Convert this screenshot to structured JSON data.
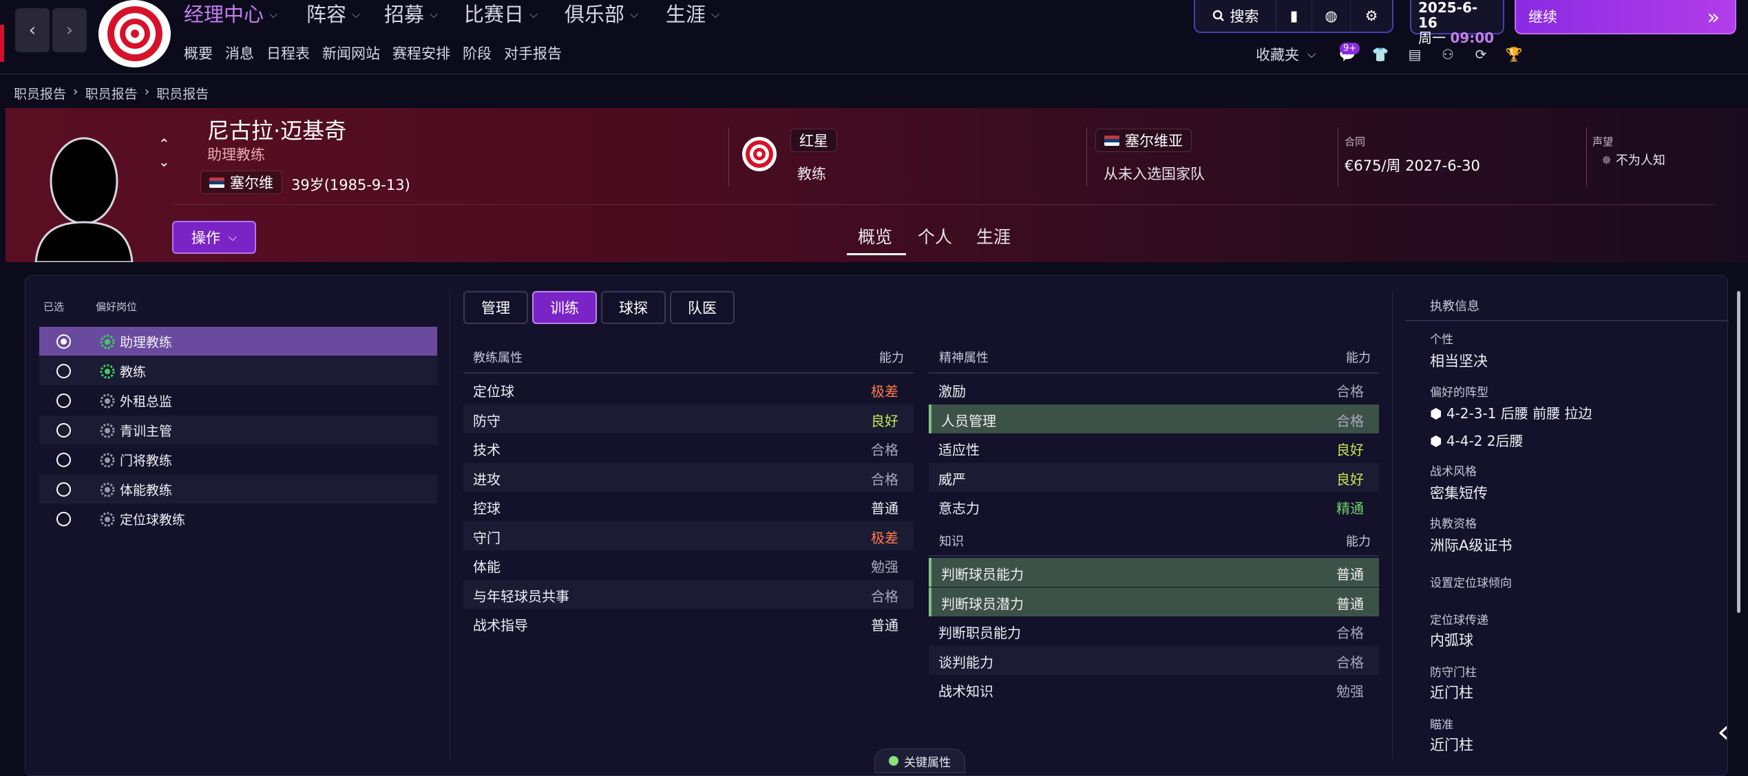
{
  "nav": {
    "main": [
      {
        "label": "经理中心"
      },
      {
        "label": "阵容"
      },
      {
        "label": "招募"
      },
      {
        "label": "比赛日"
      },
      {
        "label": "俱乐部"
      },
      {
        "label": "生涯"
      }
    ],
    "sub": [
      "概要",
      "消息",
      "日程表",
      "新闻网站",
      "赛程安排",
      "阶段",
      "对手报告"
    ],
    "search_label": "搜索",
    "date": "2025-6-16",
    "weekday": "周一",
    "time": "09:00",
    "continue_label": "继续",
    "favorites_label": "收藏夹",
    "message_badge": "9+"
  },
  "breadcrumb": [
    "职员报告",
    "职员报告",
    "职员报告"
  ],
  "profile": {
    "name": "尼古拉·迈基奇",
    "role": "助理教练",
    "nationality": "塞尔维",
    "age": "39岁(1985-9-13)",
    "club": "红星",
    "club_role": "教练",
    "national_team": "塞尔维亚",
    "national_status": "从未入选国家队",
    "contract_label": "合同",
    "contract_value": "€675/周  2027-6-30",
    "reputation_label": "声望",
    "reputation_value": "不为人知",
    "action_label": "操作",
    "tabs": [
      "概览",
      "个人",
      "生涯"
    ]
  },
  "positions": {
    "header_selected": "已选",
    "header_position": "偏好岗位",
    "items": [
      {
        "label": "助理教练",
        "selected": true,
        "star_color": "#3ecf5a"
      },
      {
        "label": "教练",
        "selected": false,
        "star_color": "#3ecf5a"
      },
      {
        "label": "外租总监",
        "selected": false,
        "star_color": "#9a98a8"
      },
      {
        "label": "青训主管",
        "selected": false,
        "star_color": "#9a98a8"
      },
      {
        "label": "门将教练",
        "selected": false,
        "star_color": "#9a98a8"
      },
      {
        "label": "体能教练",
        "selected": false,
        "star_color": "#9a98a8"
      },
      {
        "label": "定位球教练",
        "selected": false,
        "star_color": "#9a98a8"
      }
    ]
  },
  "subtabs": [
    "管理",
    "训练",
    "球探",
    "队医"
  ],
  "coaching": {
    "header": "教练属性",
    "ability_header": "能力",
    "rows": [
      {
        "name": "定位球",
        "value": "极差",
        "tone": "bad"
      },
      {
        "name": "防守",
        "value": "良好",
        "tone": "good"
      },
      {
        "name": "技术",
        "value": "合格",
        "tone": "grey"
      },
      {
        "name": "进攻",
        "value": "合格",
        "tone": "grey"
      },
      {
        "name": "控球",
        "value": "普通",
        "tone": "mid"
      },
      {
        "name": "守门",
        "value": "极差",
        "tone": "bad"
      },
      {
        "name": "体能",
        "value": "勉强",
        "tone": "grey"
      },
      {
        "name": "与年轻球员共事",
        "value": "合格",
        "tone": "grey"
      },
      {
        "name": "战术指导",
        "value": "普通",
        "tone": "mid"
      }
    ]
  },
  "mental": {
    "header": "精神属性",
    "ability_header": "能力",
    "rows": [
      {
        "name": "激励",
        "value": "合格",
        "tone": "grey"
      },
      {
        "name": "人员管理",
        "value": "合格",
        "tone": "grey"
      },
      {
        "name": "适应性",
        "value": "良好",
        "tone": "good"
      },
      {
        "name": "威严",
        "value": "良好",
        "tone": "good"
      },
      {
        "name": "意志力",
        "value": "精通",
        "tone": "green"
      }
    ]
  },
  "knowledge": {
    "header": "知识",
    "ability_header": "能力",
    "rows": [
      {
        "name": "判断球员能力",
        "value": "普通",
        "tone": "mid"
      },
      {
        "name": "判断球员潜力",
        "value": "普通",
        "tone": "mid"
      },
      {
        "name": "判断职员能力",
        "value": "合格",
        "tone": "grey"
      },
      {
        "name": "谈判能力",
        "value": "合格",
        "tone": "grey"
      },
      {
        "name": "战术知识",
        "value": "勉强",
        "tone": "grey"
      }
    ]
  },
  "info": {
    "title": "执教信息",
    "personality_label": "个性",
    "personality": "相当坚决",
    "formation_label": "偏好的阵型",
    "formation_1": "4-2-3-1 后腰 前腰 拉边",
    "formation_2": "4-4-2 2后腰",
    "style_label": "战术风格",
    "style": "密集短传",
    "license_label": "执教资格",
    "license": "洲际A级证书",
    "setpiece_label": "设置定位球倾向",
    "delivery_label": "定位球传递",
    "delivery": "内弧球",
    "post_label": "防守门柱",
    "post": "近门柱",
    "aim_label": "瞄准",
    "aim": "近门柱"
  },
  "key_attributes_label": "关键属性",
  "colors": {
    "accent": "#7a24c6",
    "header_red": "#5a0e22",
    "bad": "#ff7a4a",
    "good": "#c8e850",
    "excellent": "#72d16a"
  }
}
